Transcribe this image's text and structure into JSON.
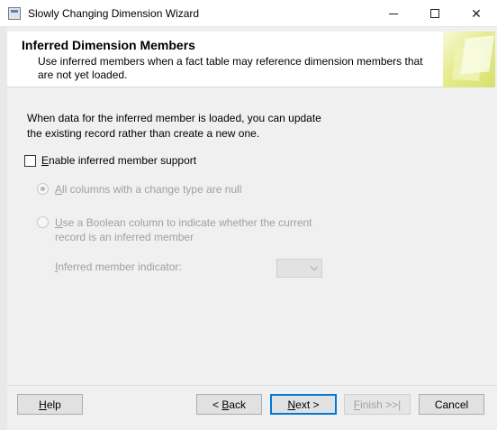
{
  "window": {
    "title": "Slowly Changing Dimension Wizard",
    "icon": "wizard-app-icon"
  },
  "header": {
    "title": "Inferred Dimension Members",
    "description": "Use inferred members when a fact table may reference dimension members that are not yet loaded."
  },
  "main": {
    "intro": "When data for the inferred member is loaded, you can update the existing record rather than create a new one.",
    "enable_checkbox": {
      "label_mnemonic": "E",
      "label_rest": "nable inferred member support",
      "checked": false
    },
    "option_all_null": {
      "label_mnemonic": "A",
      "label_rest": "ll columns with a change type are null",
      "selected": true,
      "enabled": false
    },
    "option_boolean": {
      "label_mnemonic": "U",
      "label_rest": "se a Boolean column to indicate whether the current record is an inferred member",
      "selected": false,
      "enabled": false
    },
    "indicator": {
      "label_mnemonic": "I",
      "label_rest": "nferred member indicator:",
      "value": "",
      "enabled": false
    }
  },
  "footer": {
    "help": {
      "mnemonic": "H",
      "rest": "elp"
    },
    "back": {
      "prefix": "< ",
      "mnemonic": "B",
      "rest": "ack"
    },
    "next": {
      "mnemonic": "N",
      "rest": "ext >"
    },
    "finish": {
      "mnemonic": "F",
      "rest": "inish >>|"
    },
    "cancel": "Cancel"
  }
}
